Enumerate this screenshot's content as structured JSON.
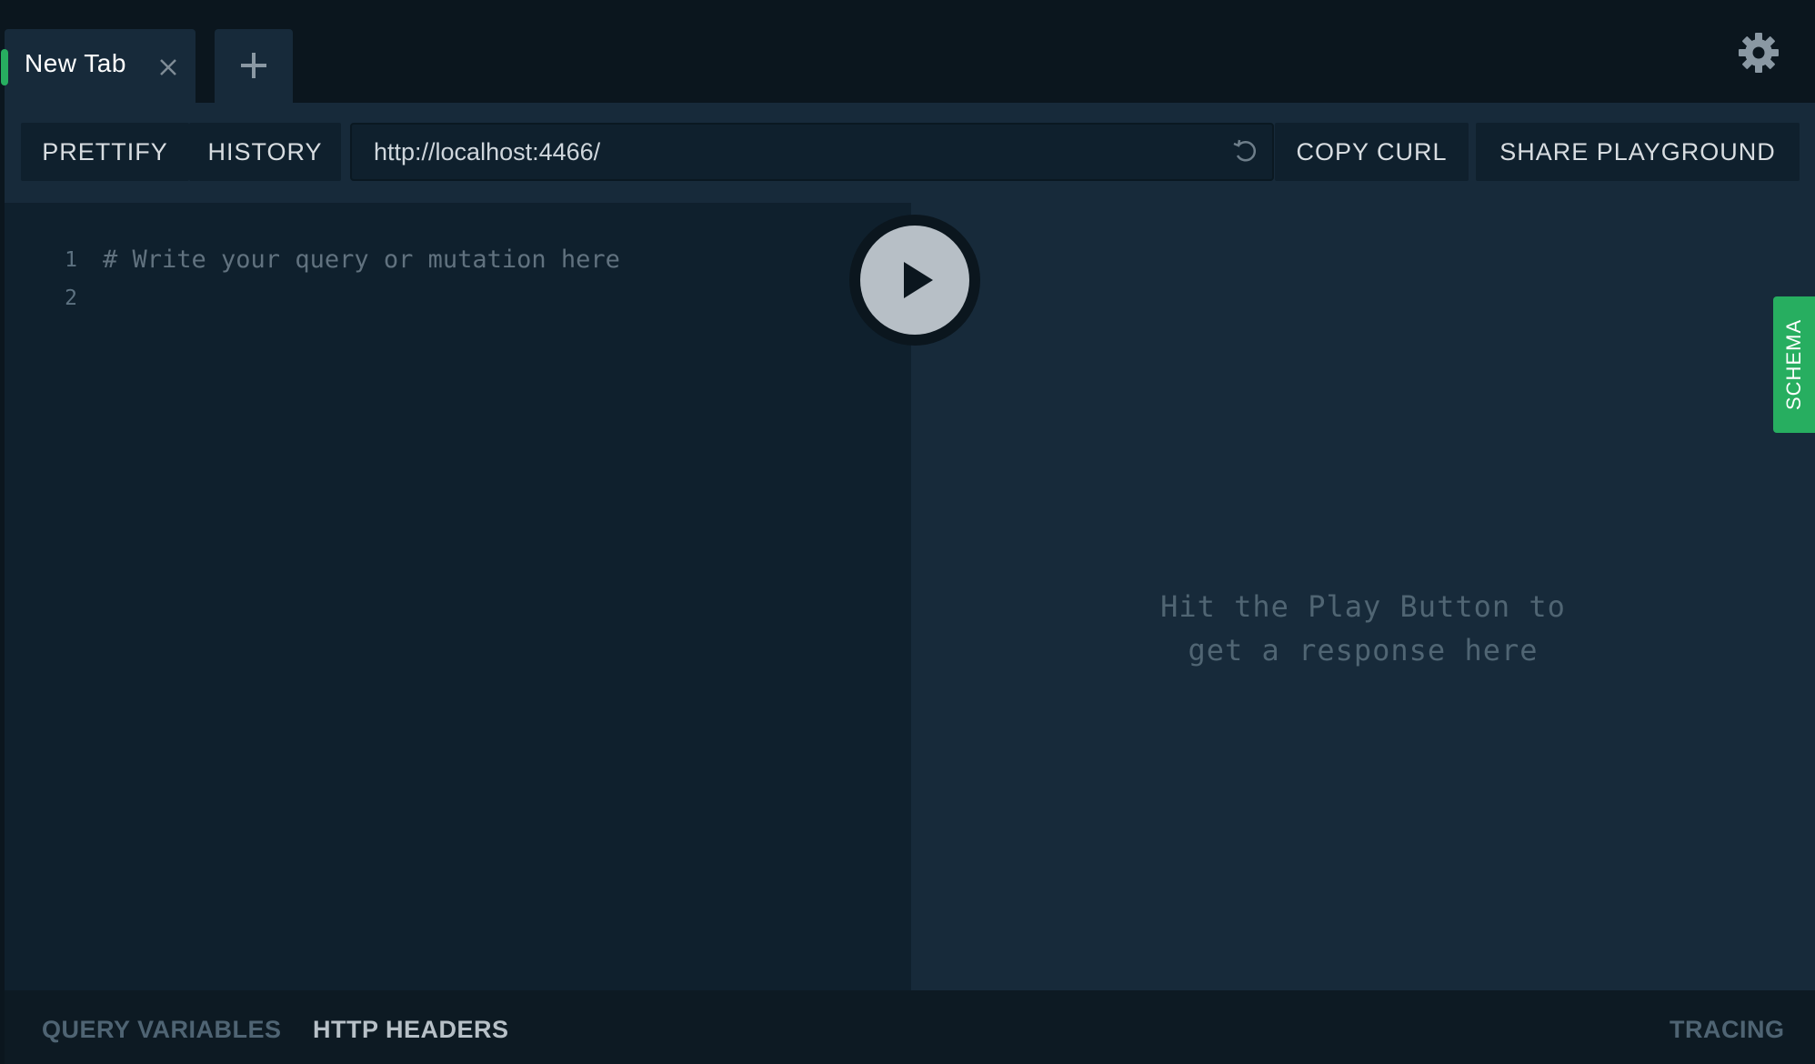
{
  "tabs": [
    {
      "title": "New Tab"
    }
  ],
  "toolbar": {
    "prettify_label": "PRETTIFY",
    "history_label": "HISTORY",
    "endpoint_url": "http://localhost:4466/",
    "copy_curl_label": "COPY CURL",
    "share_label": "SHARE PLAYGROUND"
  },
  "editor": {
    "line_numbers": [
      "1",
      "2"
    ],
    "lines": [
      "# Write your query or mutation here",
      ""
    ]
  },
  "result": {
    "placeholder": "Hit the Play Button to\nget a response here"
  },
  "schema_tab_label": "SCHEMA",
  "bottom": {
    "query_variables_label": "QUERY VARIABLES",
    "http_headers_label": "HTTP HEADERS",
    "tracing_label": "TRACING"
  },
  "colors": {
    "accent_green": "#27ae60",
    "background": "#0b161e",
    "panel": "#172a3a",
    "editor": "#0f202d"
  }
}
